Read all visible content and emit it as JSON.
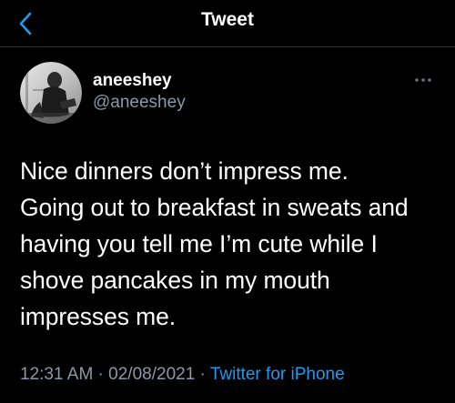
{
  "header": {
    "title": "Tweet"
  },
  "author": {
    "display_name": "aneeshey",
    "handle": "@aneeshey"
  },
  "tweet": {
    "lines": [
      "Nice dinners don’t impress me.",
      "Going out to breakfast in sweats and",
      "having you tell me I’m cute while I",
      "shove pancakes in my mouth",
      "impresses me."
    ],
    "time": "12:31 AM",
    "separator_1": " · ",
    "date": "02/08/2021",
    "separator_2": " · ",
    "source": "Twitter for iPhone"
  },
  "icons": {
    "back": "chevron-left-icon",
    "more": "more-horizontal-icon"
  },
  "colors": {
    "background": "#000000",
    "text": "#ffffff",
    "secondary_text": "#8b98a5",
    "accent": "#1d9bf0",
    "divider": "#2f3336"
  }
}
